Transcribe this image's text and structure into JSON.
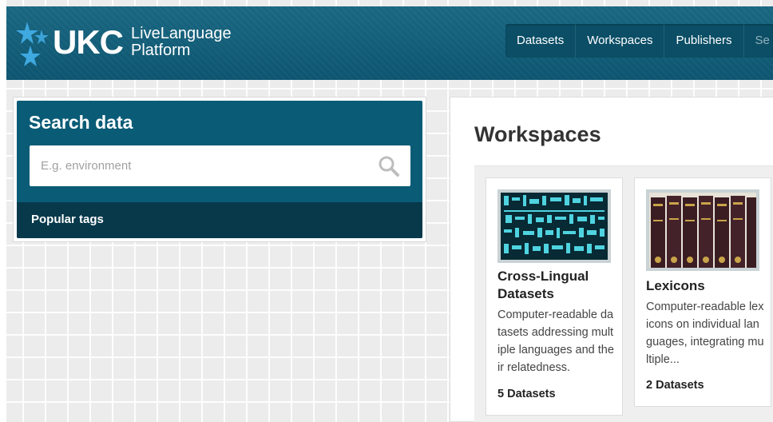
{
  "header": {
    "logo_main": "UKC",
    "logo_line1": "LiveLanguage",
    "logo_line2": "Platform",
    "nav": [
      "Datasets",
      "Workspaces",
      "Publishers",
      "Se"
    ]
  },
  "search": {
    "title": "Search data",
    "placeholder": "E.g. environment",
    "popular_label": "Popular tags"
  },
  "workspaces": {
    "title": "Workspaces",
    "cards": [
      {
        "title": "Cross-Lingual Datasets",
        "description": "Computer-readable datasets addressing multiple languages and their relatedness.",
        "count": "5 Datasets"
      },
      {
        "title": "Lexicons",
        "description": "Computer-readable lexicons on individual languages, integrating multiple...",
        "count": "2 Datasets"
      }
    ]
  },
  "colors": {
    "header": "#105c77",
    "search_panel": "#0a5b76",
    "popular_bar": "#07394b",
    "star": "#3fa9e0"
  }
}
